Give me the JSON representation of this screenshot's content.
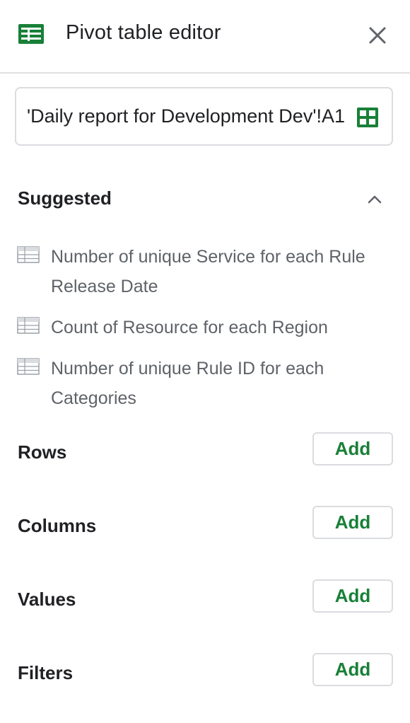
{
  "header": {
    "title": "Pivot table editor",
    "logo_icon": "sheets-logo-icon",
    "close_icon": "close-icon"
  },
  "range": {
    "value": "'Daily report for Development Dev'!A1",
    "grid_icon": "grid-select-icon"
  },
  "suggested": {
    "title": "Suggested",
    "collapse_icon": "chevron-up-icon",
    "items": [
      {
        "label": "Number of unique Service for each Rule Release Date",
        "icon": "table-icon"
      },
      {
        "label": "Count of Resource for each Region",
        "icon": "table-icon"
      },
      {
        "label": "Number of unique Rule ID for each Categories",
        "icon": "table-icon"
      }
    ]
  },
  "sections": [
    {
      "label": "Rows",
      "button": "Add"
    },
    {
      "label": "Columns",
      "button": "Add"
    },
    {
      "label": "Values",
      "button": "Add"
    },
    {
      "label": "Filters",
      "button": "Add"
    }
  ],
  "colors": {
    "accent_green": "#188038",
    "sheets_green": "#0F9D58",
    "text_primary": "#202124",
    "text_secondary": "#5f6368",
    "border": "#dadce0"
  }
}
